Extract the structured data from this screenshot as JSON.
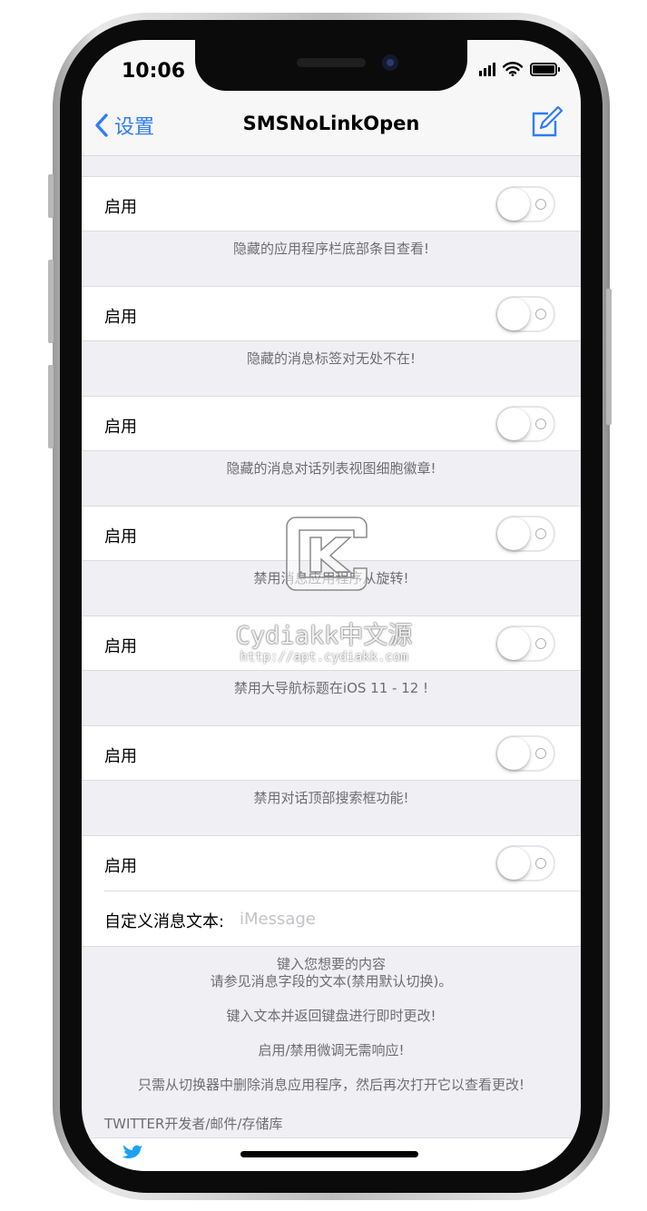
{
  "status_bar": {
    "time": "10:06"
  },
  "nav": {
    "back_label": "设置",
    "title": "SMSNoLinkOpen"
  },
  "sections": [
    {
      "toggle_label": "启用",
      "on": false,
      "footer": "隐藏的应用程序栏底部条目查看!"
    },
    {
      "toggle_label": "启用",
      "on": false,
      "footer": "隐藏的消息标签对无处不在!"
    },
    {
      "toggle_label": "启用",
      "on": false,
      "footer": "隐藏的消息对话列表视图细胞徽章!"
    },
    {
      "toggle_label": "启用",
      "on": false,
      "footer": "禁用消息应用程序从旋转!"
    },
    {
      "toggle_label": "启用",
      "on": false,
      "footer": "禁用大导航标题在iOS 11 - 12 !"
    },
    {
      "toggle_label": "启用",
      "on": false,
      "footer": "禁用对话顶部搜索框功能!"
    }
  ],
  "last_group": {
    "toggle_label": "启用",
    "on": false,
    "text_field_label": "自定义消息文本:",
    "text_field_placeholder": "iMessage"
  },
  "description": {
    "line1": "键入您想要的内容",
    "line2": "请参见消息字段的文本(禁用默认切换)。",
    "line3": "键入文本并返回键盘进行即时更改!",
    "line4": "启用/禁用微调无需响应!",
    "line5": "只需从切换器中删除消息应用程序，然后再次打开它以查看更改!"
  },
  "links_header": "TWITTER开发者/邮件/存储库",
  "watermark": {
    "text": "Cydiakk中文源",
    "url": "http://apt.cydiakk.com"
  },
  "colors": {
    "accent": "#2f7cf6",
    "background": "#efeff4",
    "footer_text": "#6d6d72"
  }
}
